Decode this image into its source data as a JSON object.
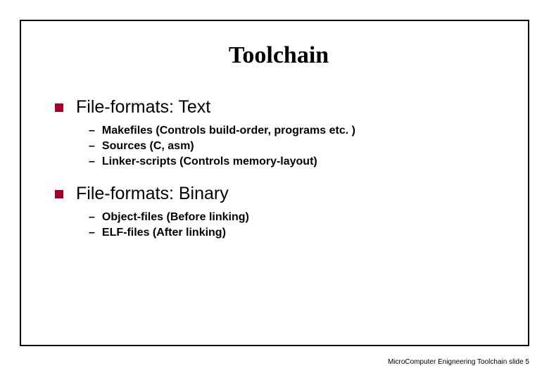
{
  "title": "Toolchain",
  "sections": [
    {
      "heading": "File-formats: Text",
      "items": [
        "Makefiles (Controls build-order, programs etc. )",
        "Sources (C, asm)",
        "Linker-scripts (Controls memory-layout)"
      ]
    },
    {
      "heading": "File-formats: Binary",
      "items": [
        "Object-files (Before linking)",
        "ELF-files (After linking)"
      ]
    }
  ],
  "footer": "MicroComputer Enigneering  Toolchain slide 5",
  "colors": {
    "accent": "#a3002a"
  }
}
